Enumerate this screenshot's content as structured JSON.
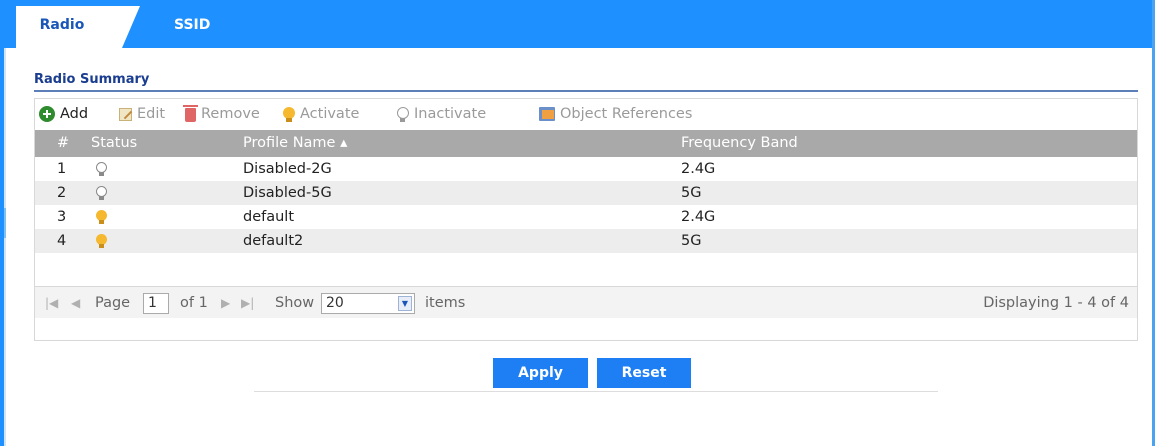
{
  "tabs": [
    {
      "label": "Radio",
      "active": true
    },
    {
      "label": "SSID",
      "active": false
    }
  ],
  "section": {
    "title": "Radio Summary"
  },
  "toolbar": {
    "add": "Add",
    "edit": "Edit",
    "remove": "Remove",
    "activate": "Activate",
    "inactivate": "Inactivate",
    "object_references": "Object References"
  },
  "table": {
    "columns": {
      "index": "#",
      "status": "Status",
      "profile_name": "Profile Name ▴",
      "frequency_band": "Frequency Band"
    },
    "rows": [
      {
        "index": "1",
        "status": "inactive",
        "profile_name": "Disabled-2G",
        "frequency_band": "2.4G"
      },
      {
        "index": "2",
        "status": "inactive",
        "profile_name": "Disabled-5G",
        "frequency_band": "5G"
      },
      {
        "index": "3",
        "status": "active",
        "profile_name": "default",
        "frequency_band": "2.4G"
      },
      {
        "index": "4",
        "status": "active",
        "profile_name": "default2",
        "frequency_band": "5G"
      }
    ]
  },
  "pager": {
    "page_label": "Page",
    "page_value": "1",
    "of_label": "of 1",
    "show_label": "Show",
    "show_value": "20",
    "items_label": "items",
    "displaying": "Displaying 1 - 4 of 4"
  },
  "buttons": {
    "apply": "Apply",
    "reset": "Reset"
  },
  "colors": {
    "accent": "#1e90ff",
    "button": "#1e7ff5",
    "header_gray": "#a9a9a9",
    "title_blue": "#1a3d8f",
    "bulb_on": "#f5b82e"
  }
}
